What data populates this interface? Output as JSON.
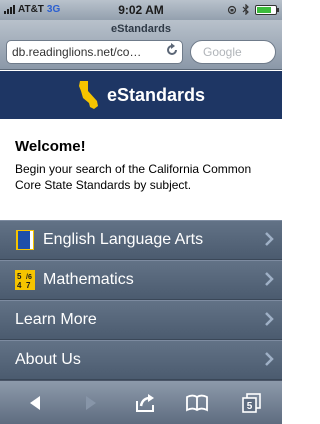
{
  "status_bar": {
    "carrier": "AT&T",
    "network": "3G",
    "time": "9:02 AM",
    "battery_level": 0.8
  },
  "browser": {
    "page_title": "eStandards",
    "url": "db.readinglions.net/co…",
    "search_placeholder": "Google"
  },
  "header": {
    "title": "eStandards",
    "logo_color": "#f5c400"
  },
  "welcome": {
    "heading": "Welcome!",
    "text": "Begin your search of the California Common Core State Standards by subject."
  },
  "menu": [
    {
      "label": "English Language Arts",
      "icon": "book-icon"
    },
    {
      "label": "Mathematics",
      "icon": "math-icon"
    },
    {
      "label": "Learn More",
      "icon": ""
    },
    {
      "label": "About Us",
      "icon": ""
    }
  ],
  "toolbar": {
    "tab_count": "5"
  },
  "colors": {
    "header_bg": "#1e3664",
    "menu_bg": "#55657a",
    "accent": "#f5c400"
  }
}
